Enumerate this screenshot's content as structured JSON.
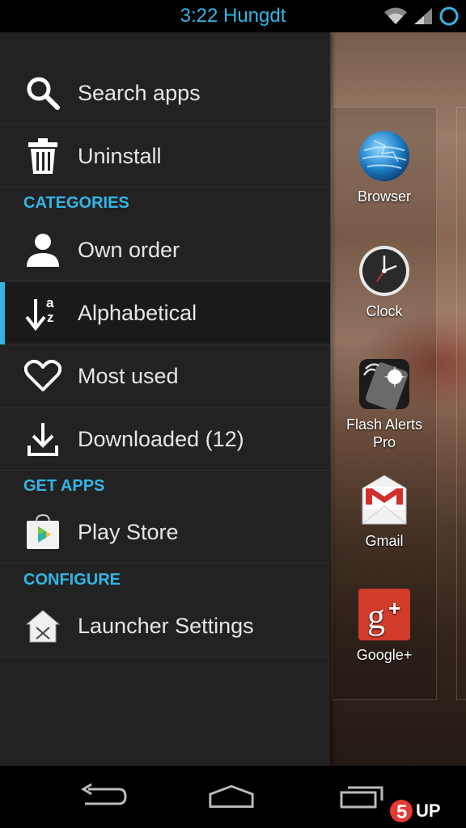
{
  "status_bar": {
    "clock": "3:22 Hungdt"
  },
  "drawer": {
    "items": [
      {
        "label": "Search apps",
        "icon": "search-icon"
      },
      {
        "label": "Uninstall",
        "icon": "trash-icon"
      },
      {
        "label": "Own order",
        "icon": "person-icon"
      },
      {
        "label": "Alphabetical",
        "icon": "sort-az-icon",
        "selected": true
      },
      {
        "label": "Most used",
        "icon": "heart-icon"
      },
      {
        "label": "Downloaded (12)",
        "icon": "download-icon"
      },
      {
        "label": "Play Store",
        "icon": "play-store-icon"
      },
      {
        "label": "Launcher Settings",
        "icon": "launcher-settings-icon"
      }
    ],
    "sections": {
      "categories": "CATEGORIES",
      "get_apps": "GET APPS",
      "configure": "CONFIGURE"
    }
  },
  "apps": [
    {
      "label": "Browser",
      "icon": "browser-globe-icon"
    },
    {
      "label": "Clock",
      "icon": "clock-icon"
    },
    {
      "label": "Flash Alerts Pro",
      "icon": "flash-alerts-icon"
    },
    {
      "label": "Gmail",
      "icon": "gmail-icon"
    },
    {
      "label": "Google+",
      "icon": "google-plus-icon"
    }
  ],
  "watermark": {
    "text": "5UP"
  },
  "colors": {
    "accent": "#33b5e5",
    "drawer_bg": "#222222"
  }
}
